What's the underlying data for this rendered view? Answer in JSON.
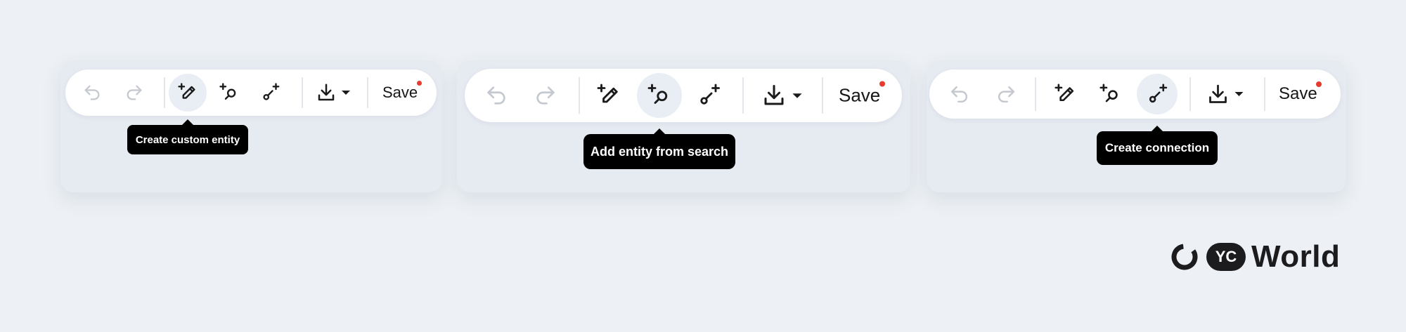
{
  "panels": [
    {
      "id": "p1",
      "active_tool": "create-custom-entity",
      "tooltip": "Create custom entity",
      "save_label": "Save"
    },
    {
      "id": "p2",
      "active_tool": "add-entity-from-search",
      "tooltip": "Add entity from search",
      "save_label": "Save"
    },
    {
      "id": "p3",
      "active_tool": "create-connection",
      "tooltip": "Create connection",
      "save_label": "Save"
    }
  ],
  "icons": {
    "undo": "undo-icon",
    "redo": "redo-icon",
    "create_entity": "pencil-plus-icon",
    "search_entity": "search-plus-icon",
    "connection": "connection-plus-icon",
    "download": "download-icon",
    "dropdown": "caret-down-icon"
  },
  "colors": {
    "background": "#edf1f5",
    "panel": "#e6eaf1",
    "toolbar": "#ffffff",
    "active_button": "#e9eef5",
    "disabled_icon": "#c4c8cf",
    "unsaved_dot": "#e63b2e",
    "tooltip": "#000000"
  },
  "brand": {
    "badge": "YC",
    "name": "World"
  }
}
